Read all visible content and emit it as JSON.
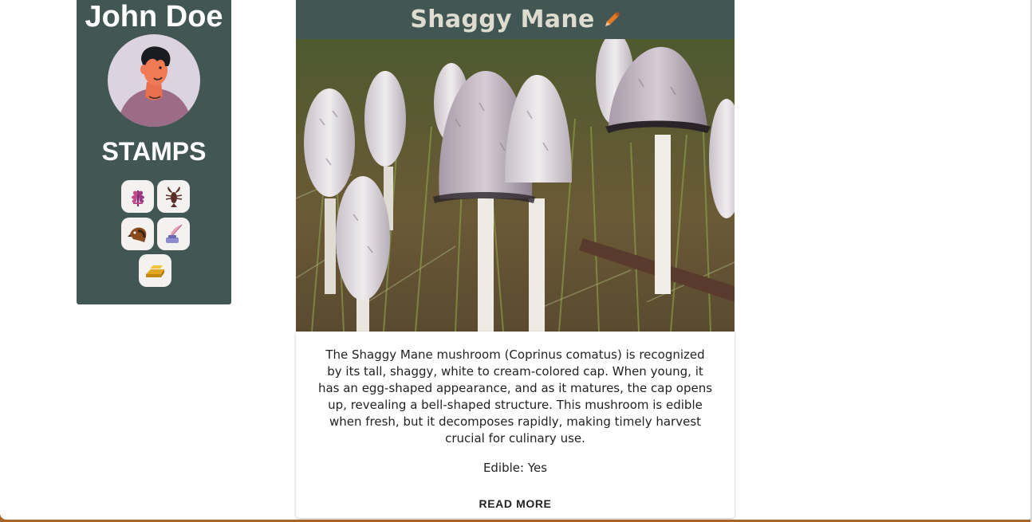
{
  "profile": {
    "user_name": "John Doe",
    "avatar_icon": "person-avatar-icon",
    "stamps_title": "STAMPS",
    "stamps": [
      {
        "icon": "purple-plant-stamp-icon"
      },
      {
        "icon": "lobster-stamp-icon"
      },
      {
        "icon": "bird-head-stamp-icon"
      },
      {
        "icon": "quill-inkpot-stamp-icon"
      },
      {
        "icon": "gold-bars-stamp-icon"
      }
    ]
  },
  "card": {
    "title": "Shaggy Mane",
    "edit_icon": "pencil-icon",
    "image_alt": "Shaggy Mane mushrooms",
    "description": "The Shaggy Mane mushroom (Coprinus comatus) is recognized by its tall, shaggy, white to cream-colored cap. When young, it has an egg-shaped appearance, and as it matures, the cap opens up, revealing a bell-shaped structure. This mushroom is edible when fresh, but it decomposes rapidly, making timely harvest crucial for culinary use.",
    "edible_line": "Edible: Yes",
    "read_more_label": "READ MORE"
  },
  "colors": {
    "panel": "#425753",
    "header_text": "#dedbcf",
    "page_bg": "#ffffff",
    "frame": "#a8652a"
  }
}
